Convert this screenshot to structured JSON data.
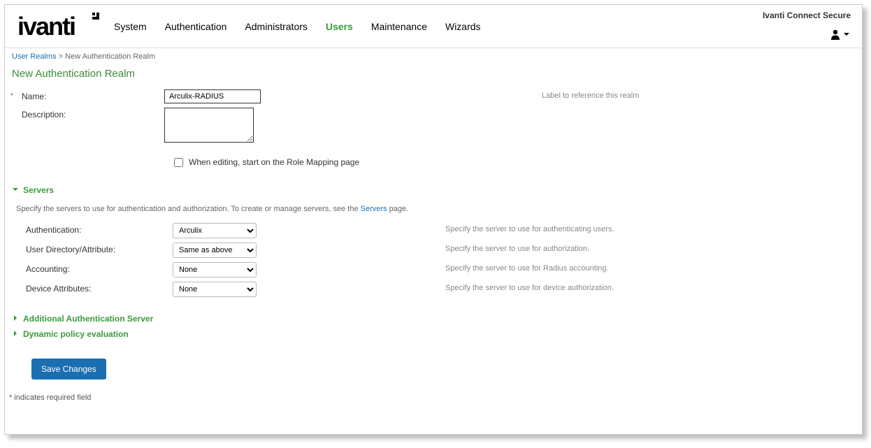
{
  "product_name": "Ivanti Connect Secure",
  "logo_text": "ivanti",
  "nav": {
    "items": [
      {
        "label": "System",
        "active": false
      },
      {
        "label": "Authentication",
        "active": false
      },
      {
        "label": "Administrators",
        "active": false
      },
      {
        "label": "Users",
        "active": true
      },
      {
        "label": "Maintenance",
        "active": false
      },
      {
        "label": "Wizards",
        "active": false
      }
    ]
  },
  "breadcrumb": {
    "link_text": "User Realms",
    "separator": ">",
    "current": "New Authentication Realm"
  },
  "page_title": "New Authentication Realm",
  "form": {
    "name_label": "Name:",
    "name_value": "Arculix-RADIUS",
    "name_hint": "Label to reference this realm",
    "description_label": "Description:",
    "description_value": "",
    "role_mapping_checkbox_label": "When editing, start on the Role Mapping page",
    "role_mapping_checked": false
  },
  "servers_section": {
    "title": "Servers",
    "description_prefix": "Specify the servers to use for authentication and authorization. To create or manage servers, see the ",
    "description_link": "Servers",
    "description_suffix": " page.",
    "rows": [
      {
        "label": "Authentication:",
        "value": "Arculix",
        "hint": "Specify the server to use for authenticating users."
      },
      {
        "label": "User Directory/Attribute:",
        "value": "Same as above",
        "hint": "Specify the server to use for authorization."
      },
      {
        "label": "Accounting:",
        "value": "None",
        "hint": "Specify the server to use for Radius accounting."
      },
      {
        "label": "Device Attributes:",
        "value": "None",
        "hint": "Specify the server to use for device authorization."
      }
    ]
  },
  "collapsibles": {
    "additional_auth": "Additional Authentication Server",
    "dynamic_policy": "Dynamic policy evaluation"
  },
  "buttons": {
    "save": "Save Changes"
  },
  "footnote": "* indicates required field"
}
